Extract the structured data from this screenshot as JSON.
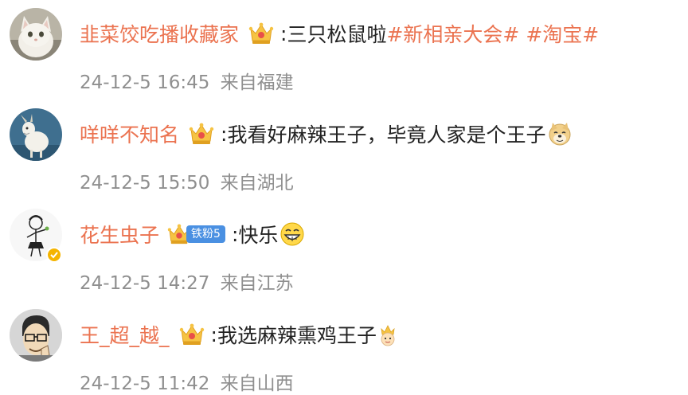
{
  "comments": [
    {
      "username": "韭菜饺吃播收藏家",
      "separator": ":",
      "text": "三只松鼠啦",
      "hashtags": [
        "#新相亲大会#",
        "#淘宝#"
      ],
      "hashtag_gap": " ",
      "time": "24-12-5 16:45",
      "location": "来自福建",
      "avatar": "white-cat-avatar",
      "badge": "crown-icon"
    },
    {
      "username": "咩咩不知名",
      "separator": ":",
      "text": "我看好麻辣王子，毕竟人家是个王子",
      "emoji": "doge-emoji",
      "time": "24-12-5 15:50",
      "location": "来自湖北",
      "avatar": "goat-avatar",
      "badge": "crown-icon"
    },
    {
      "username": "花生虫子",
      "separator": ":",
      "text": "快乐",
      "emoji": "grin-emoji",
      "fan_label": "铁粉5",
      "time": "24-12-5 14:27",
      "location": "来自江苏",
      "avatar": "sketch-figure-avatar",
      "badge": "crown-icon",
      "verified": "verified-icon"
    },
    {
      "username": "王_超_越_",
      "separator": ":",
      "text": "我选麻辣熏鸡王子",
      "emoji": "prince-emoji",
      "time": "24-12-5 11:42",
      "location": "来自山西",
      "avatar": "cartoon-man-avatar",
      "badge": "crown-icon"
    }
  ],
  "colors": {
    "username": "#eb7350",
    "hashtag": "#eb7350",
    "text": "#222222",
    "meta": "#8f8f8f",
    "fan_pill": "#4a90e2",
    "verified": "#f5b400"
  }
}
